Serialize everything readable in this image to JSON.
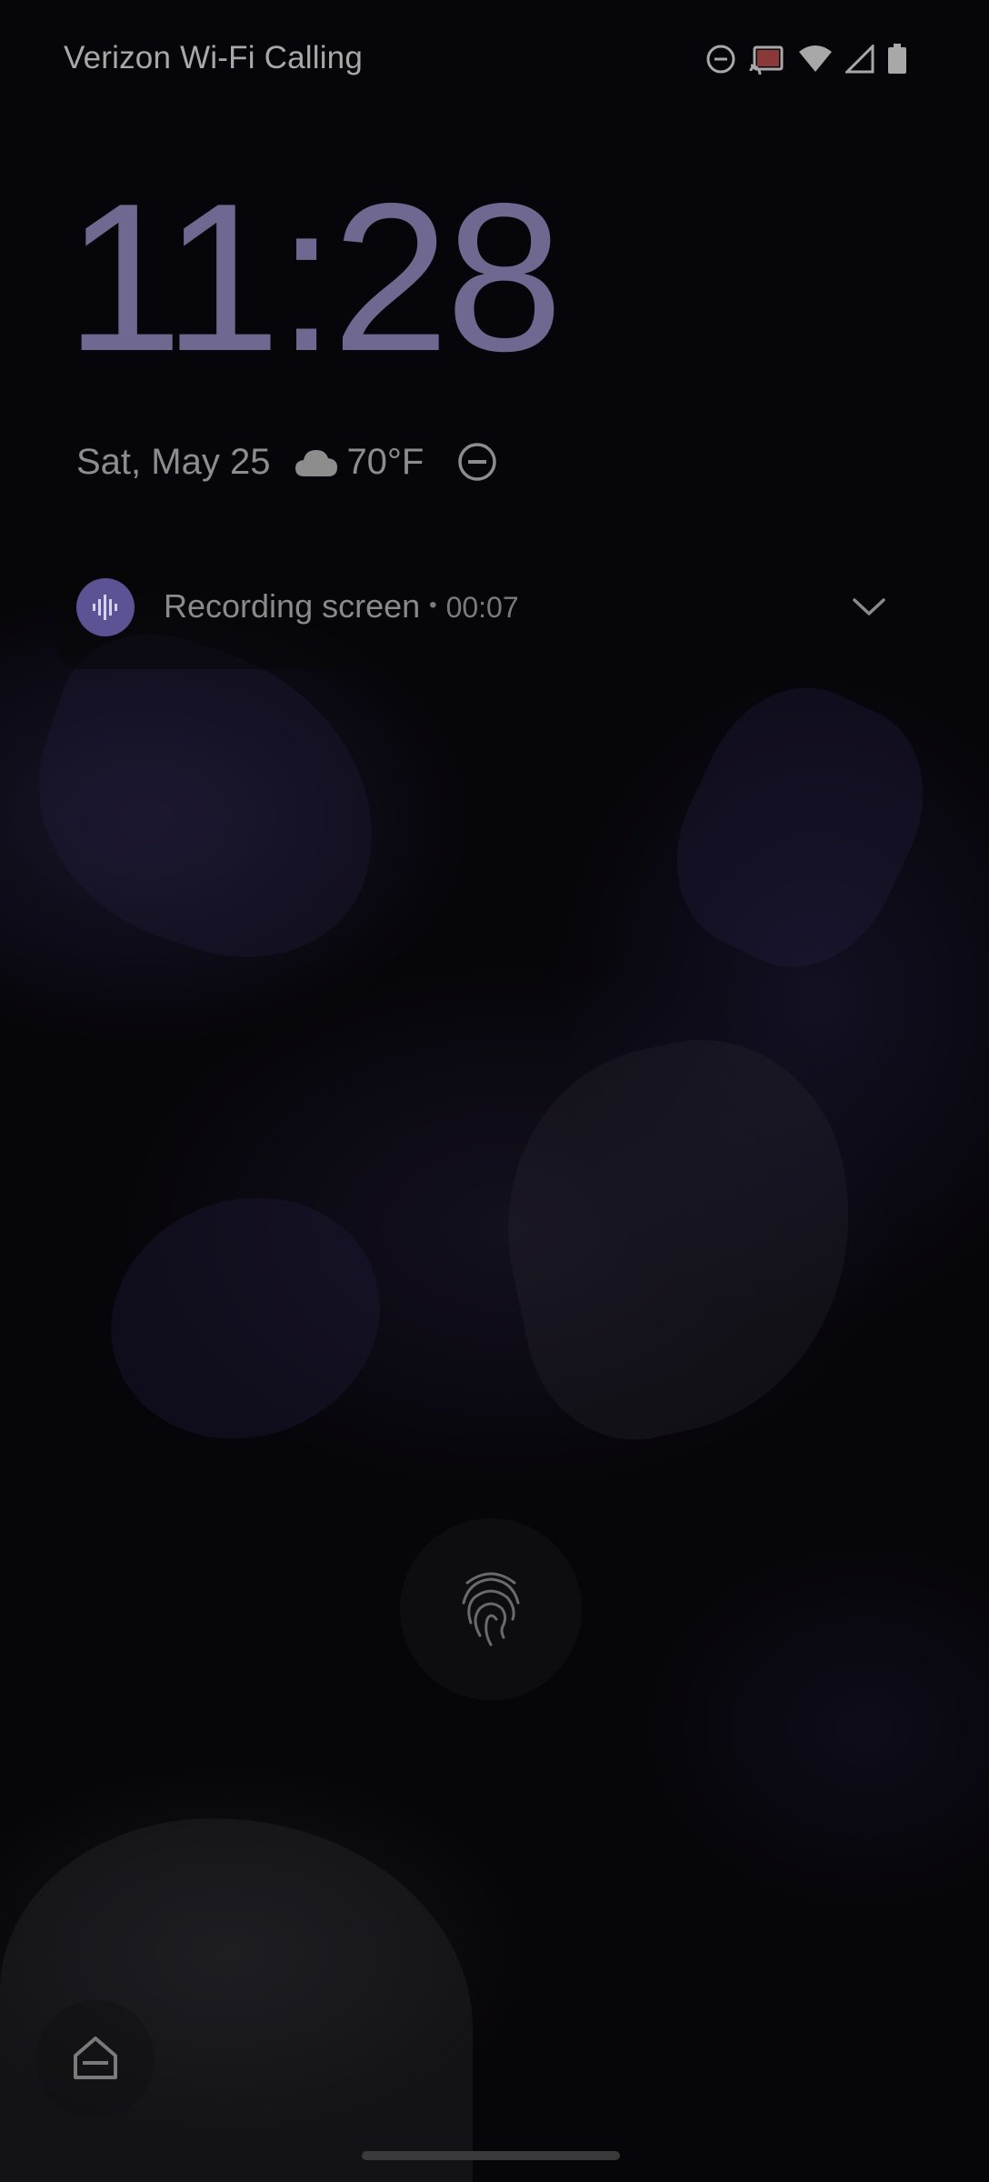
{
  "status_bar": {
    "carrier": "Verizon Wi-Fi Calling",
    "icons": [
      "do-not-disturb-icon",
      "cast-icon",
      "wifi-icon",
      "cell-signal-icon",
      "battery-icon"
    ]
  },
  "lockscreen": {
    "time": "11:28",
    "date": "Sat, May 25",
    "weather_icon": "cloud-icon",
    "temperature": "70°F",
    "dnd_icon": "do-not-disturb-icon"
  },
  "notification": {
    "app_icon": "sound-wave-icon",
    "title": "Recording screen",
    "separator": "•",
    "elapsed": "00:07",
    "expand_icon": "chevron-down-icon"
  },
  "unlock": {
    "icon": "fingerprint-icon"
  },
  "shortcut": {
    "icon": "home-icon"
  },
  "colors": {
    "clock": "#6f6890",
    "accent": "#5b5394",
    "text": "#a8a8a8",
    "background": "#000000"
  }
}
